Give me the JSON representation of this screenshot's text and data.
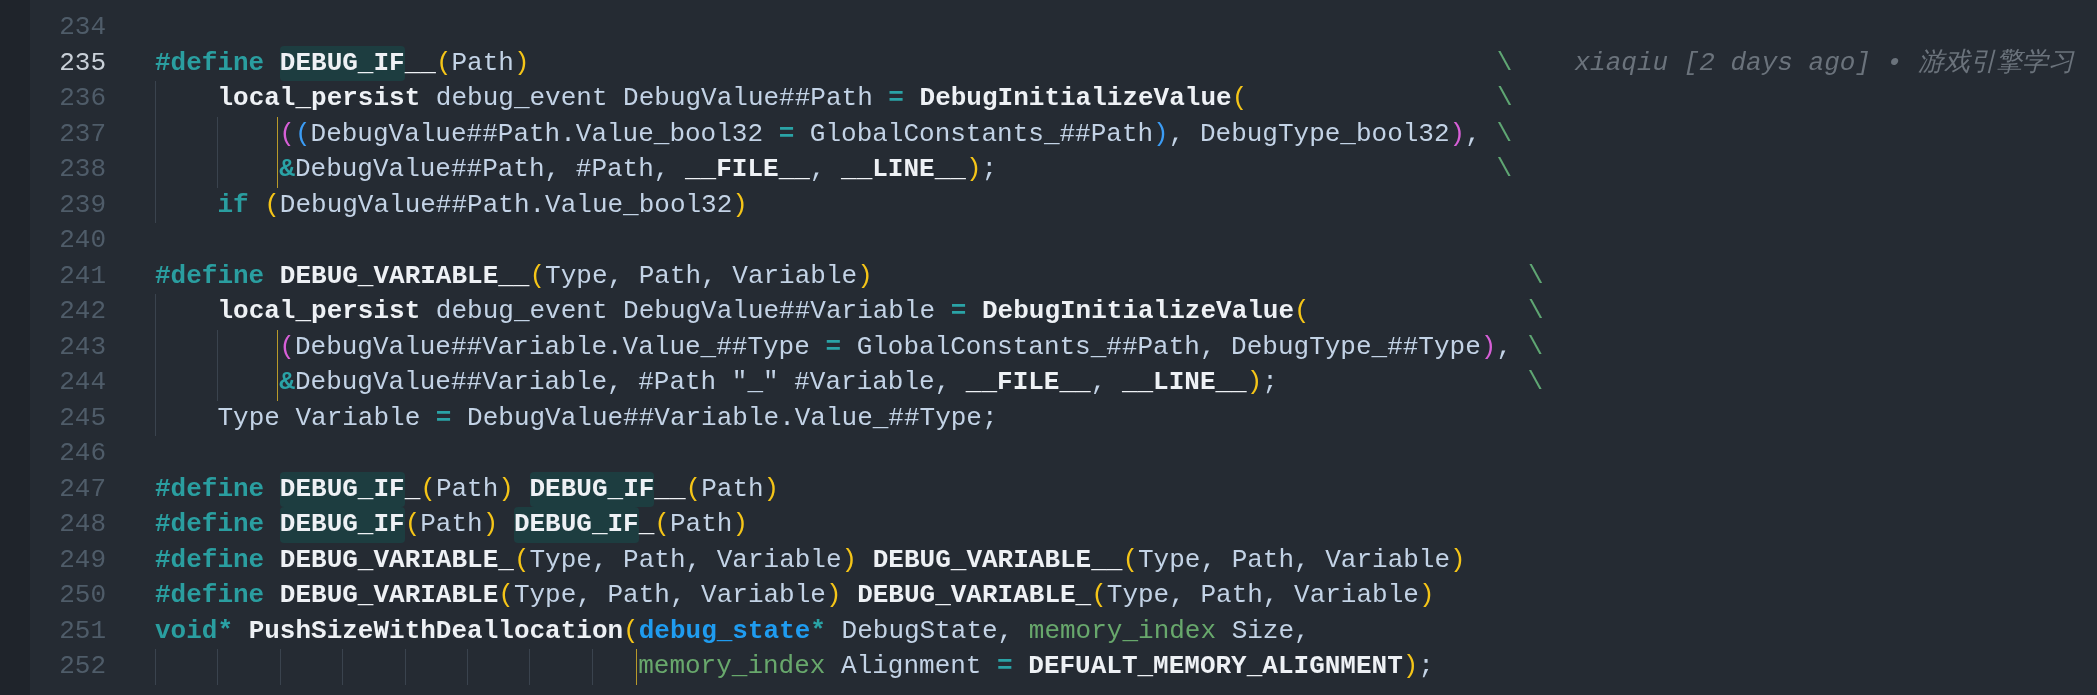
{
  "lines": [
    {
      "number": "234",
      "active": false
    },
    {
      "number": "235",
      "active": true,
      "tokens": [
        {
          "kind": "keyword",
          "text": "#define "
        },
        {
          "kind": "macro",
          "text": "DEBUG_IF",
          "highlight": true
        },
        {
          "kind": "macro",
          "text": "__"
        },
        {
          "kind": "bracket",
          "color": "#f5c518",
          "text": "("
        },
        {
          "kind": "ident",
          "text": "Path"
        },
        {
          "kind": "bracket",
          "color": "#f5c518",
          "text": ")"
        },
        {
          "kind": "continuation",
          "text": "                                                              \\"
        }
      ],
      "annotation": "xiaqiu [2 days ago] • 游戏引擎学习"
    },
    {
      "number": "236",
      "active": false,
      "tokens": [
        {
          "kind": "storage",
          "text": "    local_persist"
        },
        {
          "kind": "ident",
          "text": " debug_event DebugValue##Path "
        },
        {
          "kind": "operator",
          "text": "= "
        },
        {
          "kind": "macro",
          "text": "DebugInitializeValue"
        },
        {
          "kind": "bracket",
          "color": "#f5c518",
          "text": "("
        },
        {
          "kind": "continuation",
          "text": "                \\"
        }
      ]
    },
    {
      "number": "237",
      "active": false,
      "bracket_guide": true,
      "tokens": [
        {
          "kind": "bracket",
          "color": "#d75fd7",
          "text": "        ("
        },
        {
          "kind": "bracket",
          "color": "#3b9cf5",
          "text": "("
        },
        {
          "kind": "ident",
          "text": "DebugValue##Path.Value_bool32 "
        },
        {
          "kind": "operator",
          "text": "= "
        },
        {
          "kind": "ident",
          "text": "GlobalConstants_##Path"
        },
        {
          "kind": "bracket",
          "color": "#3b9cf5",
          "text": ")"
        },
        {
          "kind": "ident",
          "text": ", DebugType_bool32"
        },
        {
          "kind": "bracket",
          "color": "#d75fd7",
          "text": ")"
        },
        {
          "kind": "ident",
          "text": ","
        },
        {
          "kind": "continuation",
          "text": " \\"
        }
      ]
    },
    {
      "number": "238",
      "active": false,
      "bracket_guide": true,
      "tokens": [
        {
          "kind": "operator",
          "text": "        &"
        },
        {
          "kind": "ident",
          "text": "DebugValue##Path, #Path, "
        },
        {
          "kind": "macro",
          "text": "__FILE__"
        },
        {
          "kind": "ident",
          "text": ", "
        },
        {
          "kind": "macro",
          "text": "__LINE__"
        },
        {
          "kind": "bracket",
          "color": "#f5c518",
          "text": ")"
        },
        {
          "kind": "ident",
          "text": ";"
        },
        {
          "kind": "continuation",
          "text": "                                \\"
        }
      ]
    },
    {
      "number": "239",
      "active": false,
      "tokens": [
        {
          "kind": "keyword",
          "text": "    if "
        },
        {
          "kind": "bracket",
          "color": "#f5c518",
          "text": "("
        },
        {
          "kind": "ident",
          "text": "DebugValue##Path.Value_bool32"
        },
        {
          "kind": "bracket",
          "color": "#f5c518",
          "text": ")"
        }
      ]
    },
    {
      "number": "240",
      "active": false
    },
    {
      "number": "241",
      "active": false,
      "tokens": [
        {
          "kind": "keyword",
          "text": "#define "
        },
        {
          "kind": "macro",
          "text": "DEBUG_VARIABLE__"
        },
        {
          "kind": "bracket",
          "color": "#f5c518",
          "text": "("
        },
        {
          "kind": "ident",
          "text": "Type, Path, Variable"
        },
        {
          "kind": "bracket",
          "color": "#f5c518",
          "text": ")"
        },
        {
          "kind": "continuation",
          "text": "                                          \\"
        }
      ]
    },
    {
      "number": "242",
      "active": false,
      "tokens": [
        {
          "kind": "storage",
          "text": "    local_persist"
        },
        {
          "kind": "ident",
          "text": " debug_event DebugValue##Variable "
        },
        {
          "kind": "operator",
          "text": "= "
        },
        {
          "kind": "macro",
          "text": "DebugInitializeValue"
        },
        {
          "kind": "bracket",
          "color": "#f5c518",
          "text": "("
        },
        {
          "kind": "continuation",
          "text": "              \\"
        }
      ]
    },
    {
      "number": "243",
      "active": false,
      "bracket_guide": true,
      "tokens": [
        {
          "kind": "bracket",
          "color": "#d75fd7",
          "text": "        ("
        },
        {
          "kind": "ident",
          "text": "DebugValue##Variable.Value_##Type "
        },
        {
          "kind": "operator",
          "text": "= "
        },
        {
          "kind": "ident",
          "text": "GlobalConstants_##Path, DebugType_##Type"
        },
        {
          "kind": "bracket",
          "color": "#d75fd7",
          "text": ")"
        },
        {
          "kind": "ident",
          "text": ","
        },
        {
          "kind": "continuation",
          "text": " \\"
        }
      ]
    },
    {
      "number": "244",
      "active": false,
      "bracket_guide": true,
      "tokens": [
        {
          "kind": "operator",
          "text": "        &"
        },
        {
          "kind": "ident",
          "text": "DebugValue##Variable, #Path \"_\" #Variable, "
        },
        {
          "kind": "macro",
          "text": "__FILE__"
        },
        {
          "kind": "ident",
          "text": ", "
        },
        {
          "kind": "macro",
          "text": "__LINE__"
        },
        {
          "kind": "bracket",
          "color": "#f5c518",
          "text": ")"
        },
        {
          "kind": "ident",
          "text": ";"
        },
        {
          "kind": "continuation",
          "text": "                \\"
        }
      ]
    },
    {
      "number": "245",
      "active": false,
      "tokens": [
        {
          "kind": "ident",
          "text": "    Type Variable "
        },
        {
          "kind": "operator",
          "text": "= "
        },
        {
          "kind": "ident",
          "text": "DebugValue##Variable.Value_##Type;"
        }
      ]
    },
    {
      "number": "246",
      "active": false
    },
    {
      "number": "247",
      "active": false,
      "tokens": [
        {
          "kind": "keyword",
          "text": "#define "
        },
        {
          "kind": "macro",
          "text": "DEBUG_IF",
          "highlight": true
        },
        {
          "kind": "macro",
          "text": "_"
        },
        {
          "kind": "bracket",
          "color": "#f5c518",
          "text": "("
        },
        {
          "kind": "ident",
          "text": "Path"
        },
        {
          "kind": "bracket",
          "color": "#f5c518",
          "text": ") "
        },
        {
          "kind": "macro",
          "text": "DEBUG_IF",
          "highlight": true
        },
        {
          "kind": "macro",
          "text": "__"
        },
        {
          "kind": "bracket",
          "color": "#f5c518",
          "text": "("
        },
        {
          "kind": "ident",
          "text": "Path"
        },
        {
          "kind": "bracket",
          "color": "#f5c518",
          "text": ")"
        }
      ]
    },
    {
      "number": "248",
      "active": false,
      "tokens": [
        {
          "kind": "keyword",
          "text": "#define "
        },
        {
          "kind": "macro",
          "text": "DEBUG_IF",
          "highlight": true
        },
        {
          "kind": "bracket",
          "color": "#f5c518",
          "text": "("
        },
        {
          "kind": "ident",
          "text": "Path"
        },
        {
          "kind": "bracket",
          "color": "#f5c518",
          "text": ") "
        },
        {
          "kind": "macro",
          "text": "DEBUG_IF",
          "highlight": true
        },
        {
          "kind": "macro",
          "text": "_"
        },
        {
          "kind": "bracket",
          "color": "#f5c518",
          "text": "("
        },
        {
          "kind": "ident",
          "text": "Path"
        },
        {
          "kind": "bracket",
          "color": "#f5c518",
          "text": ")"
        }
      ]
    },
    {
      "number": "249",
      "active": false,
      "tokens": [
        {
          "kind": "keyword",
          "text": "#define "
        },
        {
          "kind": "macro",
          "text": "DEBUG_VARIABLE_"
        },
        {
          "kind": "bracket",
          "color": "#f5c518",
          "text": "("
        },
        {
          "kind": "ident",
          "text": "Type, Path, Variable"
        },
        {
          "kind": "bracket",
          "color": "#f5c518",
          "text": ") "
        },
        {
          "kind": "macro",
          "text": "DEBUG_VARIABLE__"
        },
        {
          "kind": "bracket",
          "color": "#f5c518",
          "text": "("
        },
        {
          "kind": "ident",
          "text": "Type, Path, Variable"
        },
        {
          "kind": "bracket",
          "color": "#f5c518",
          "text": ")"
        }
      ]
    },
    {
      "number": "250",
      "active": false,
      "tokens": [
        {
          "kind": "keyword",
          "text": "#define "
        },
        {
          "kind": "macro",
          "text": "DEBUG_VARIABLE"
        },
        {
          "kind": "bracket",
          "color": "#f5c518",
          "text": "("
        },
        {
          "kind": "ident",
          "text": "Type, Path, Variable"
        },
        {
          "kind": "bracket",
          "color": "#f5c518",
          "text": ") "
        },
        {
          "kind": "macro",
          "text": "DEBUG_VARIABLE_"
        },
        {
          "kind": "bracket",
          "color": "#f5c518",
          "text": "("
        },
        {
          "kind": "ident",
          "text": "Type, Path, Variable"
        },
        {
          "kind": "bracket",
          "color": "#f5c518",
          "text": ")"
        }
      ]
    },
    {
      "number": "251",
      "active": false,
      "tokens": [
        {
          "kind": "keyword",
          "text": "void"
        },
        {
          "kind": "pointer",
          "text": "* "
        },
        {
          "kind": "macro",
          "text": "PushSizeWithDeallocation"
        },
        {
          "kind": "bracket",
          "color": "#f5c518",
          "text": "("
        },
        {
          "kind": "type",
          "text": "debug_state"
        },
        {
          "kind": "pointer",
          "text": "*"
        },
        {
          "kind": "ident",
          "text": " DebugState, "
        },
        {
          "kind": "param_type",
          "text": "memory_index"
        },
        {
          "kind": "ident",
          "text": " Size,"
        }
      ]
    },
    {
      "number": "252",
      "active": false,
      "bracket_guide": true,
      "tokens": [
        {
          "kind": "param_type",
          "text": "                               memory_index"
        },
        {
          "kind": "ident",
          "text": " Alignment "
        },
        {
          "kind": "operator",
          "text": "= "
        },
        {
          "kind": "macro",
          "text": "DEFUALT_MEMORY_ALIGNMENT"
        },
        {
          "kind": "bracket",
          "color": "#f5c518",
          "text": ")"
        },
        {
          "kind": "ident",
          "text": ";"
        }
      ]
    }
  ]
}
